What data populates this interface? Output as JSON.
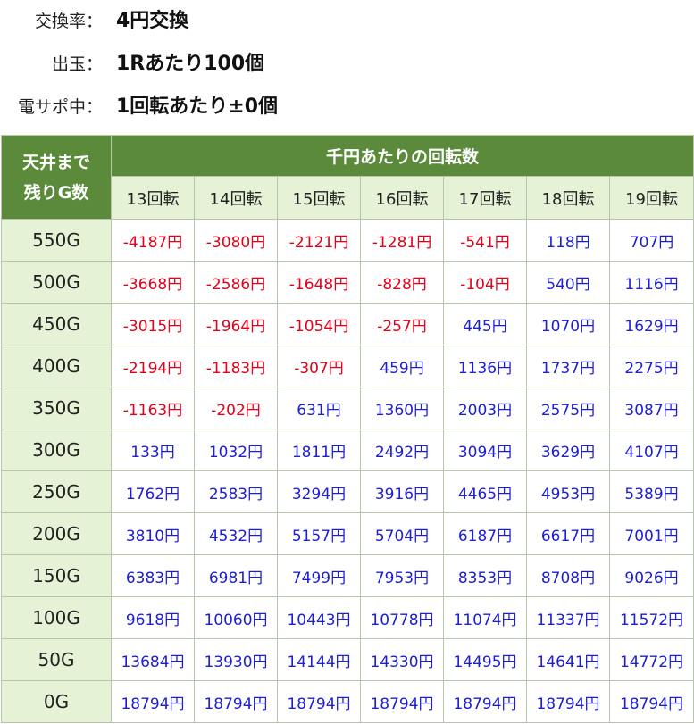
{
  "info": {
    "rate_label": "交換率：",
    "rate_value": "4円交換",
    "payout_label": "出玉：",
    "payout_value": "1Rあたり100個",
    "support_label": "電サポ中：",
    "support_value": "1回転あたり±0個"
  },
  "table": {
    "corner_line1": "天井まで",
    "corner_line2": "残りG数",
    "group_header": "千円あたりの回転数",
    "columns": [
      "13回転",
      "14回転",
      "15回転",
      "16回転",
      "17回転",
      "18回転",
      "19回転"
    ],
    "rows": [
      {
        "label": "550G",
        "cells": [
          "-4187円",
          "-3080円",
          "-2121円",
          "-1281円",
          "-541円",
          "118円",
          "707円"
        ]
      },
      {
        "label": "500G",
        "cells": [
          "-3668円",
          "-2586円",
          "-1648円",
          "-828円",
          "-104円",
          "540円",
          "1116円"
        ]
      },
      {
        "label": "450G",
        "cells": [
          "-3015円",
          "-1964円",
          "-1054円",
          "-257円",
          "445円",
          "1070円",
          "1629円"
        ]
      },
      {
        "label": "400G",
        "cells": [
          "-2194円",
          "-1183円",
          "-307円",
          "459円",
          "1136円",
          "1737円",
          "2275円"
        ]
      },
      {
        "label": "350G",
        "cells": [
          "-1163円",
          "-202円",
          "631円",
          "1360円",
          "2003円",
          "2575円",
          "3087円"
        ]
      },
      {
        "label": "300G",
        "cells": [
          "133円",
          "1032円",
          "1811円",
          "2492円",
          "3094円",
          "3629円",
          "4107円"
        ]
      },
      {
        "label": "250G",
        "cells": [
          "1762円",
          "2583円",
          "3294円",
          "3916円",
          "4465円",
          "4953円",
          "5389円"
        ]
      },
      {
        "label": "200G",
        "cells": [
          "3810円",
          "4532円",
          "5157円",
          "5704円",
          "6187円",
          "6617円",
          "7001円"
        ]
      },
      {
        "label": "150G",
        "cells": [
          "6383円",
          "6981円",
          "7499円",
          "7953円",
          "8353円",
          "8708円",
          "9026円"
        ]
      },
      {
        "label": "100G",
        "cells": [
          "9618円",
          "10060円",
          "10443円",
          "10778円",
          "11074円",
          "11337円",
          "11572円"
        ]
      },
      {
        "label": "50G",
        "cells": [
          "13684円",
          "13930円",
          "14144円",
          "14330円",
          "14495円",
          "14641円",
          "14772円"
        ]
      },
      {
        "label": "0G",
        "cells": [
          "18794円",
          "18794円",
          "18794円",
          "18794円",
          "18794円",
          "18794円",
          "18794円"
        ]
      }
    ]
  },
  "colors": {
    "header_green": "#5a8a3a",
    "light_green": "#e5f2d6",
    "negative": "#e3001b",
    "positive": "#1d1dd6"
  }
}
